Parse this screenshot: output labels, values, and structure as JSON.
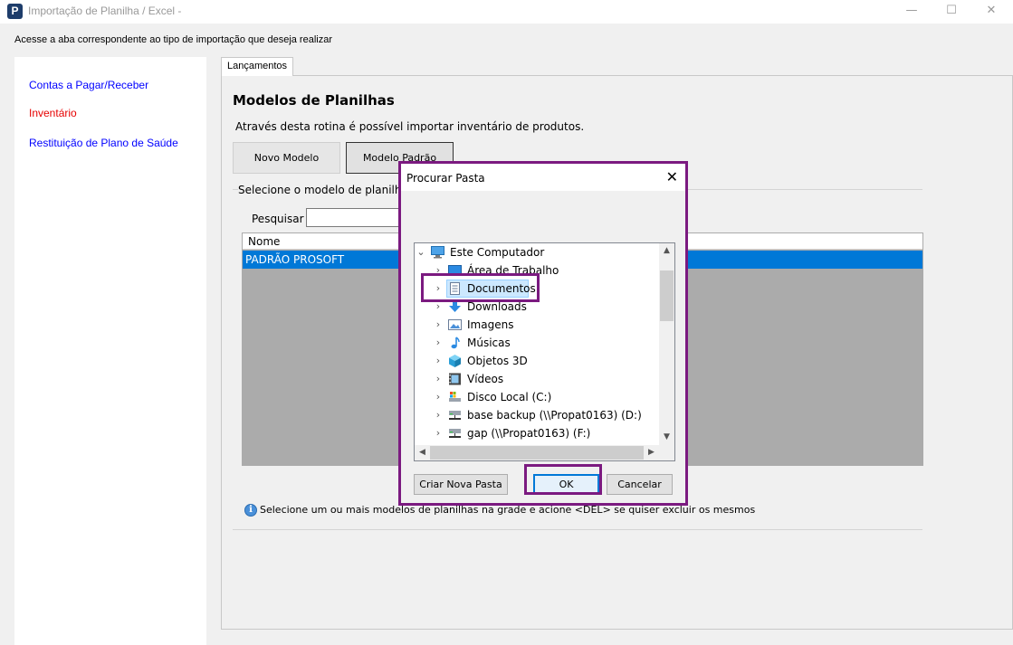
{
  "window": {
    "logo": "P",
    "title": "Importação de Planilha / Excel -",
    "minimize": "—",
    "maximize": "☐",
    "close": "✕"
  },
  "subtitle": "Acesse a aba correspondente ao tipo de importação que deseja realizar",
  "sidebar": {
    "items": [
      {
        "label": "Contas a Pagar/Receber",
        "color": "#0000ff"
      },
      {
        "label": "Inventário",
        "color": "#e60000"
      },
      {
        "label": "Restituição de Plano de Saúde",
        "color": "#0000ff"
      }
    ]
  },
  "tabs": [
    {
      "label": "Lançamentos"
    }
  ],
  "main": {
    "title": "Modelos de Planilhas",
    "description": "Através desta rotina é possível importar inventário de produtos.",
    "new_model_button": "Novo Modelo",
    "default_model_button": "Modelo Padrão",
    "group_label": "Selecione o modelo de planilha d",
    "search_label": "Pesquisar",
    "search_value": "",
    "grid": {
      "columns": [
        "Nome"
      ],
      "rows": [
        [
          "PADRÃO PROSOFT"
        ]
      ]
    },
    "info_text": "Selecione um ou mais modelos de planilhas na grade e acione <DEL> se quiser excluir os mesmos"
  },
  "dialog": {
    "title": "Procurar Pasta",
    "close": "✕",
    "tree": [
      {
        "label": "Este Computador",
        "icon": "computer-icon",
        "expanded": true
      },
      {
        "label": "Área de Trabalho",
        "icon": "desktop-icon"
      },
      {
        "label": "Documentos",
        "icon": "documents-icon",
        "selected": true
      },
      {
        "label": "Downloads",
        "icon": "downloads-icon"
      },
      {
        "label": "Imagens",
        "icon": "pictures-icon"
      },
      {
        "label": "Músicas",
        "icon": "music-icon"
      },
      {
        "label": "Objetos 3D",
        "icon": "3d-objects-icon"
      },
      {
        "label": "Vídeos",
        "icon": "videos-icon"
      },
      {
        "label": "Disco Local (C:)",
        "icon": "local-disk-icon"
      },
      {
        "label": "base backup (\\\\Propat0163) (D:)",
        "icon": "network-drive-icon"
      },
      {
        "label": "gap (\\\\Propat0163) (F:)",
        "icon": "network-drive-icon"
      }
    ],
    "new_folder_button": "Criar Nova Pasta",
    "ok_button": "OK",
    "cancel_button": "Cancelar"
  },
  "colors": {
    "highlight": "#7b1a80",
    "selection": "#0078d7"
  }
}
